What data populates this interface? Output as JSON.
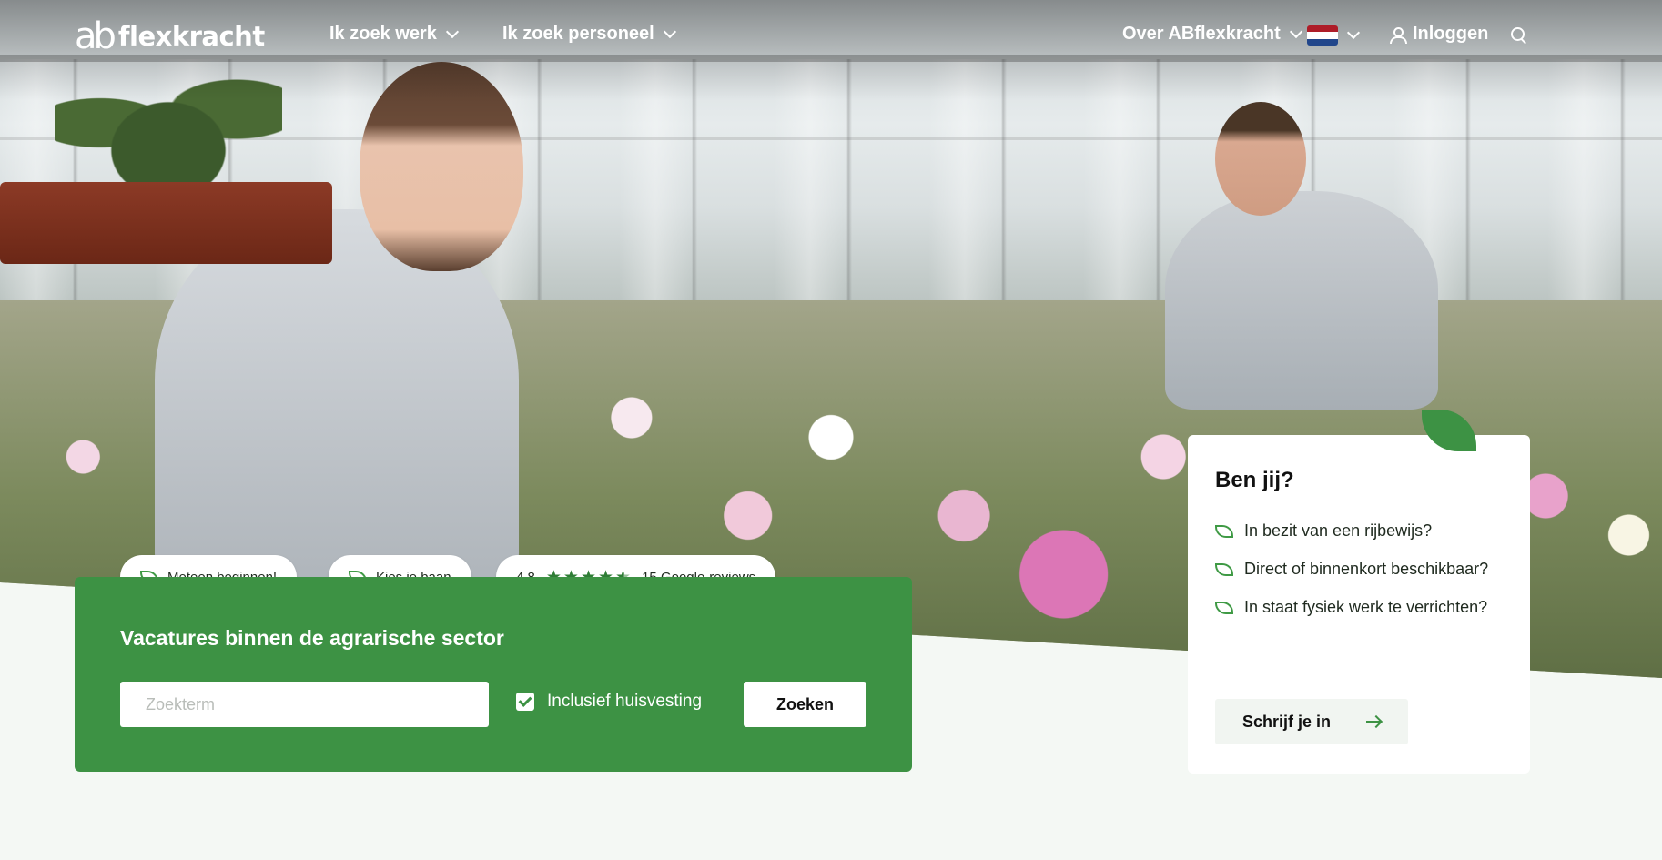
{
  "brand": {
    "logo_mark": "ab",
    "logo_text": "flexkracht"
  },
  "nav": {
    "work": "Ik zoek werk",
    "staff": "Ik zoek personeel",
    "about": "Over ABflexkracht",
    "login": "Inloggen"
  },
  "icons": {
    "chevron": "chevron-down-icon",
    "flag": "netherlands-flag-icon",
    "user": "user-icon",
    "search": "search-icon",
    "leaf": "leaf-icon",
    "star": "star-icon",
    "arrow": "arrow-right-icon"
  },
  "colors": {
    "brand_green": "#3d9244",
    "flag_red": "#ae1c28",
    "flag_white": "#ffffff",
    "flag_blue": "#21468b"
  },
  "pills": {
    "start": "Meteen beginnen!",
    "choose": "Kies je baan",
    "rating": "4.8",
    "rating_stars": 4.5,
    "reviews": "15 Google-reviews"
  },
  "search_panel": {
    "title": "Vacatures binnen de agrarische sector",
    "placeholder": "Zoekterm",
    "checkbox_label": "Inclusief huisvesting",
    "checkbox_checked": true,
    "button": "Zoeken"
  },
  "card": {
    "title": "Ben jij?",
    "items": [
      "In bezit van een rijbewijs?",
      "Direct of binnenkort beschikbaar?",
      "In staat fysiek werk te verrichten?"
    ],
    "button": "Schrijf je in"
  }
}
